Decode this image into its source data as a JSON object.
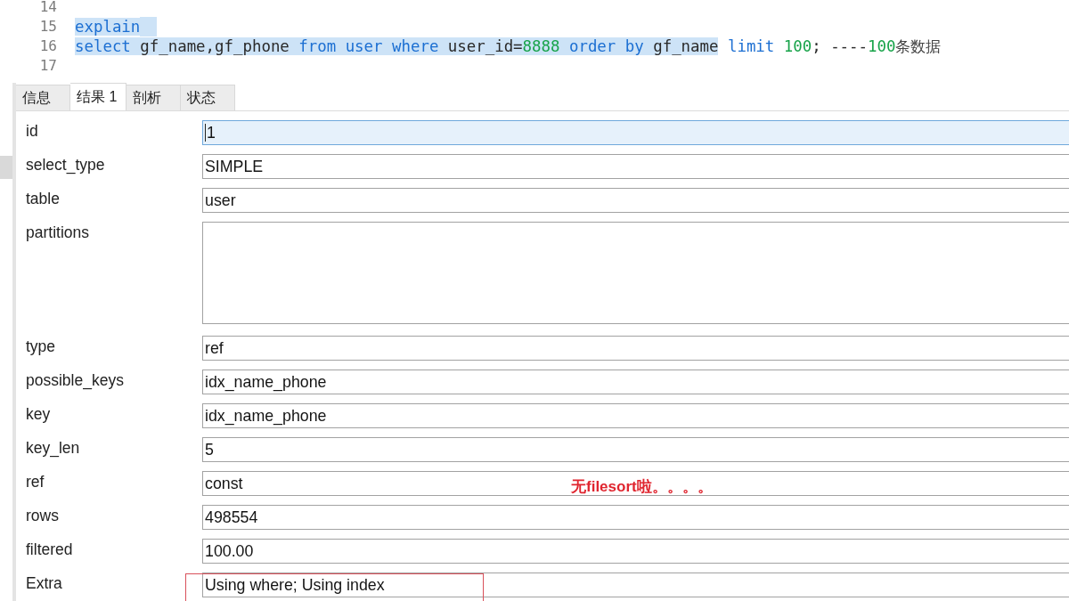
{
  "editor": {
    "lines": [
      {
        "number": "14",
        "end_selected": false
      },
      {
        "number": "15",
        "end_selected": true,
        "tokens": [
          {
            "text": "explain",
            "kind": "keyword",
            "selected": true
          }
        ]
      },
      {
        "number": "16",
        "end_selected": false,
        "tokens": [
          {
            "text": "select",
            "kind": "keyword",
            "selected": true
          },
          {
            "text": " gf_name,gf_phone ",
            "kind": "plain",
            "selected": true
          },
          {
            "text": "from user where",
            "kind": "keyword",
            "selected": true
          },
          {
            "text": " user_id=",
            "kind": "plain",
            "selected": true
          },
          {
            "text": "8888",
            "kind": "number",
            "selected": true
          },
          {
            "text": " order by",
            "kind": "keyword",
            "selected": true
          },
          {
            "text": " gf_name",
            "kind": "plain",
            "selected": true
          },
          {
            "text": " limit",
            "kind": "keyword",
            "selected": false
          },
          {
            "text": " 100",
            "kind": "number",
            "selected": false
          },
          {
            "text": "; ----",
            "kind": "plain",
            "selected": false
          },
          {
            "text": "100",
            "kind": "number",
            "selected": false
          },
          {
            "text": "条数据",
            "kind": "comment",
            "selected": false
          }
        ]
      },
      {
        "number": "17",
        "end_selected": false
      }
    ]
  },
  "tabs": [
    {
      "label": "信息",
      "selected": false
    },
    {
      "label": "结果 1",
      "selected": true
    },
    {
      "label": "剖析",
      "selected": false
    },
    {
      "label": "状态",
      "selected": false
    }
  ],
  "fields": [
    {
      "label": "id",
      "kind": "line",
      "value": "1",
      "focused": true,
      "highlighted": false
    },
    {
      "label": "select_type",
      "kind": "line",
      "value": "SIMPLE",
      "focused": false,
      "highlighted": false
    },
    {
      "label": "table",
      "kind": "line",
      "value": "user",
      "focused": false,
      "highlighted": false
    },
    {
      "label": "partitions",
      "kind": "area",
      "focused": false,
      "highlighted": false
    },
    {
      "label": "type",
      "kind": "line",
      "value": "ref",
      "focused": false,
      "highlighted": false
    },
    {
      "label": "possible_keys",
      "kind": "line",
      "value": "idx_name_phone",
      "focused": false,
      "highlighted": false
    },
    {
      "label": "key",
      "kind": "line",
      "value": "idx_name_phone",
      "focused": false,
      "highlighted": false
    },
    {
      "label": "key_len",
      "kind": "line",
      "value": "5",
      "focused": false,
      "highlighted": false
    },
    {
      "label": "ref",
      "kind": "line",
      "value": "const",
      "focused": false,
      "highlighted": false
    },
    {
      "label": "rows",
      "kind": "line",
      "value": "498554",
      "focused": false,
      "highlighted": false
    },
    {
      "label": "filtered",
      "kind": "line",
      "value": "100.00",
      "focused": false,
      "highlighted": false
    },
    {
      "label": "Extra",
      "kind": "line",
      "value": "Using where; Using index",
      "focused": false,
      "highlighted": true
    }
  ],
  "annotation": {
    "text": "无filesort啦。。。。"
  }
}
